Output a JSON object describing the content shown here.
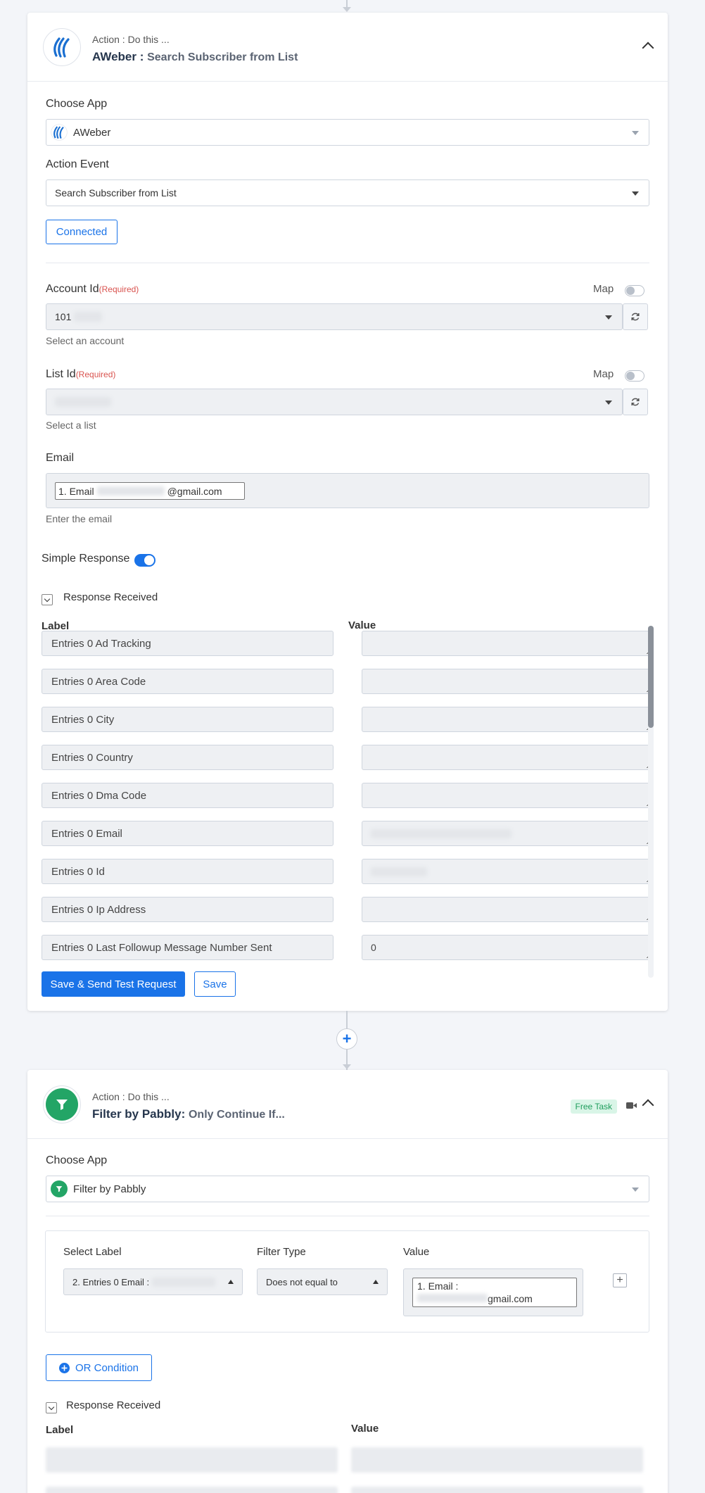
{
  "action1": {
    "subtitle": "Action : Do this ...",
    "app_name": "AWeber :",
    "event_name": "Search Subscriber from List",
    "choose_app_label": "Choose App",
    "choose_app_value": "AWeber",
    "action_event_label": "Action Event",
    "action_event_value": "Search Subscriber from List",
    "connected_label": "Connected",
    "account_label": "Account Id",
    "required_text": "(Required)",
    "map_label": "Map",
    "account_value": "101",
    "account_hint": "Select an account",
    "list_label": "List Id",
    "list_hint": "Select a list",
    "email_label": "Email",
    "email_chip_prefix": "1. Email",
    "email_chip_suffix": "@gmail.com",
    "email_hint": "Enter the email",
    "simple_response_label": "Simple Response",
    "response_received_label": "Response Received",
    "col_label": "Label",
    "col_value": "Value",
    "rows": [
      {
        "label": "Entries 0 Ad Tracking",
        "value": ""
      },
      {
        "label": "Entries 0 Area Code",
        "value": ""
      },
      {
        "label": "Entries 0 City",
        "value": ""
      },
      {
        "label": "Entries 0 Country",
        "value": ""
      },
      {
        "label": "Entries 0 Dma Code",
        "value": ""
      },
      {
        "label": "Entries 0 Email",
        "value": ""
      },
      {
        "label": "Entries 0 Id",
        "value": ""
      },
      {
        "label": "Entries 0 Ip Address",
        "value": ""
      },
      {
        "label": "Entries 0 Last Followup Message Number Sent",
        "value": "0"
      }
    ],
    "save_send_label": "Save & Send Test Request",
    "save_label": "Save"
  },
  "action2": {
    "subtitle": "Action : Do this ...",
    "app_name": "Filter by Pabbly:",
    "event_name": "Only Continue If...",
    "free_task_label": "Free Task",
    "choose_app_label": "Choose App",
    "choose_app_value": "Filter by Pabbly",
    "select_label_head": "Select Label",
    "filter_type_head": "Filter Type",
    "value_head": "Value",
    "select_label_value": "2. Entries 0 Email :",
    "filter_type_value": "Does not equal to",
    "value_chip_line1": "1. Email :",
    "value_chip_line2": "gmail.com",
    "or_condition_label": "OR Condition",
    "response_received_label": "Response Received",
    "col_label": "Label",
    "col_value": "Value"
  },
  "colors": {
    "accent": "#1a73e8",
    "filter_green": "#23a566",
    "required": "#d9534f"
  }
}
